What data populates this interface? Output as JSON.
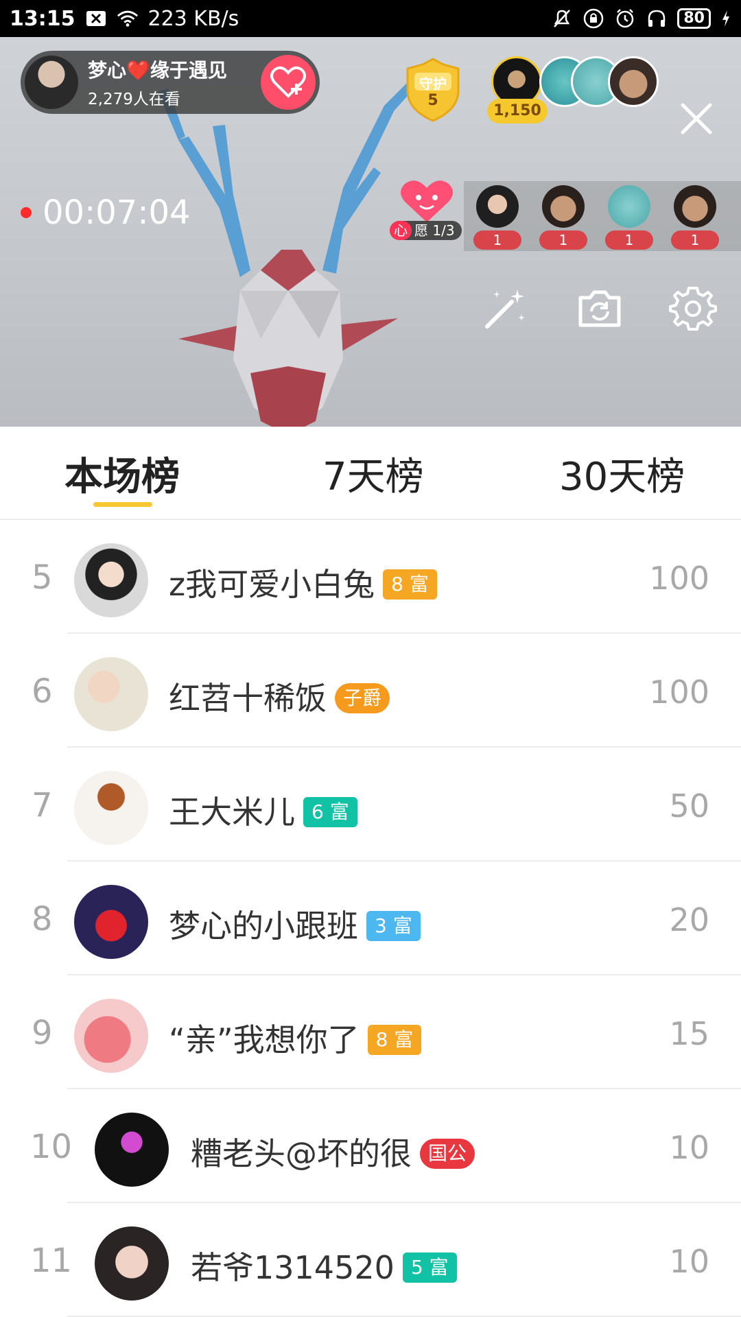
{
  "status_bar": {
    "time": "13:15",
    "net_speed": "223 KB/s",
    "battery": "80",
    "icons": [
      "notification-x-icon",
      "wifi-icon",
      "mute-bell-icon",
      "lock-icon",
      "alarm-icon",
      "headphones-icon",
      "battery-icon",
      "charging-icon"
    ]
  },
  "live": {
    "host_name": "梦心❤️缘于遇见",
    "viewers": "2,279人在看",
    "guard_label": "守护",
    "guard_count": "5",
    "coins": "1,150",
    "timer": "00:07:04",
    "wish_tag": "心",
    "wish_text": "愿 1/3",
    "contributors": [
      {
        "count": "1"
      },
      {
        "count": "1"
      },
      {
        "count": "1"
      },
      {
        "count": "1"
      }
    ]
  },
  "tabs": [
    {
      "label": "本场榜",
      "active": true
    },
    {
      "label": "7天榜",
      "active": false
    },
    {
      "label": "30天榜",
      "active": false
    }
  ],
  "ranking": [
    {
      "rank": "5",
      "name": "z我可爱小白兔",
      "badge": "8 富",
      "badge_color": "#f5a623",
      "score": "100"
    },
    {
      "rank": "6",
      "name": "红苕十稀饭",
      "badge": "子爵",
      "badge_color": "#f59a1d",
      "score": "100"
    },
    {
      "rank": "7",
      "name": "王大米儿",
      "badge": "6 富",
      "badge_color": "#12c2a5",
      "score": "50"
    },
    {
      "rank": "8",
      "name": "梦心的小跟班",
      "badge": "3 富",
      "badge_color": "#4cb8ef",
      "score": "20"
    },
    {
      "rank": "9",
      "name": "“亲”我想你了",
      "badge": "8 富",
      "badge_color": "#f5a623",
      "score": "15"
    },
    {
      "rank": "10",
      "name": "糟老头@坏的很",
      "badge": "国公",
      "badge_color": "#e8373f",
      "score": "10"
    },
    {
      "rank": "11",
      "name": "若爷1314520",
      "badge": "5 富",
      "badge_color": "#12c2a5",
      "score": "10"
    }
  ]
}
